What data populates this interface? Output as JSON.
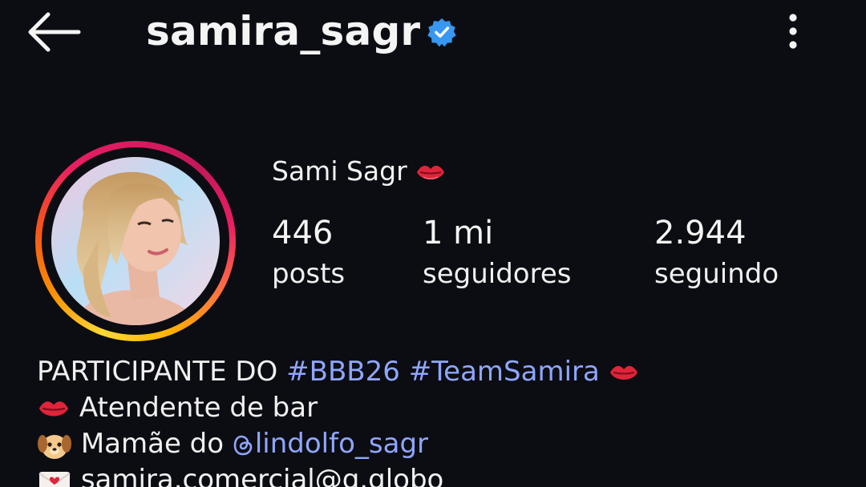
{
  "header": {
    "username": "samira_sagr",
    "verified": true,
    "back_icon": "arrow-left-icon",
    "more_icon": "more-vertical-icon"
  },
  "profile": {
    "display_name": "Sami Sagr",
    "name_emoji": "kiss-mark-icon",
    "stats": [
      {
        "value": "446",
        "label": "posts"
      },
      {
        "value": "1 mi",
        "label": "seguidores"
      },
      {
        "value": "2.944",
        "label": "seguindo"
      }
    ]
  },
  "bio": {
    "line1_text": "PARTICIPANTE DO ",
    "line1_tag1": "#BBB26",
    "line1_tag2": "#TeamSamira",
    "line2_text": "Atendente de bar",
    "line3_text": "Mamãe do ",
    "line3_mention": "lindolfo_sagr",
    "line4_text": "samira.comercial@g.globo"
  },
  "colors": {
    "background": "#0c0d12",
    "link": "#8fa6ff",
    "verified": "#3897f0"
  }
}
